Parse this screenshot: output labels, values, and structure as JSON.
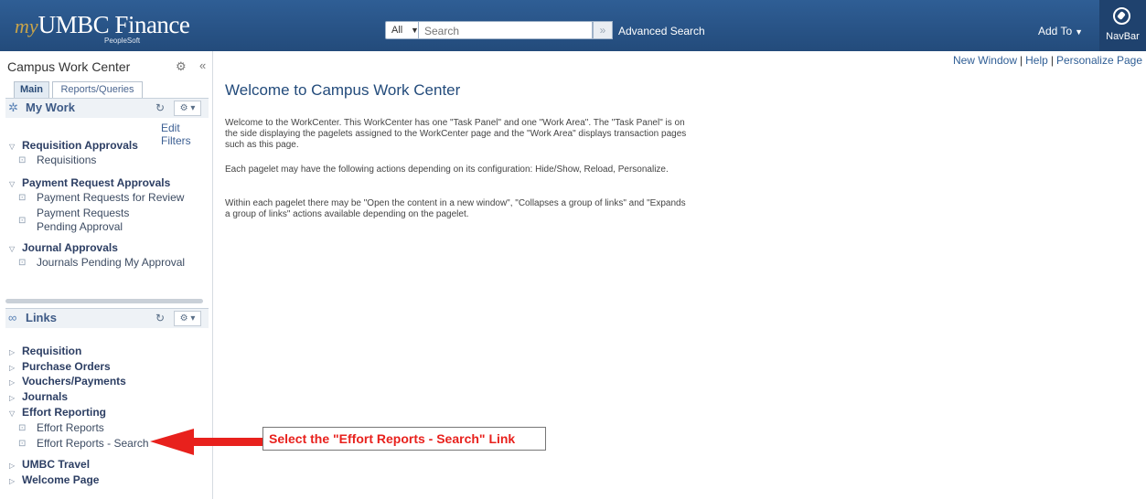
{
  "header": {
    "logo_prefix": "my",
    "logo_name": "UMBC Finance",
    "logo_sub": "PeopleSoft",
    "search_scope": "All",
    "search_placeholder": "Search",
    "advanced_search": "Advanced Search",
    "add_to": "Add To",
    "navbar": "NavBar"
  },
  "sidebar": {
    "title": "Campus Work Center",
    "tabs": [
      "Main",
      "Reports/Queries"
    ],
    "my_work": {
      "title": "My Work",
      "edit_filters": "Edit Filters",
      "groups": [
        {
          "label": "Requisition Approvals",
          "items": [
            "Requisitions"
          ]
        },
        {
          "label": "Payment Request Approvals",
          "items": [
            "Payment Requests for Review",
            "Payment Requests Pending Approval"
          ]
        },
        {
          "label": "Journal Approvals",
          "items": [
            "Journals Pending My Approval"
          ]
        }
      ]
    },
    "links": {
      "title": "Links",
      "groups": [
        "Requisition",
        "Purchase Orders",
        "Vouchers/Payments",
        "Journals",
        "Effort Reporting",
        "UMBC Travel",
        "Welcome Page"
      ],
      "effort_items": [
        "Effort Reports",
        "Effort Reports - Search"
      ]
    }
  },
  "main": {
    "top_links": [
      "New Window",
      "Help",
      "Personalize Page"
    ],
    "title": "Welcome to Campus Work Center",
    "paragraphs": [
      "Welcome to the WorkCenter. This WorkCenter has one \"Task Panel\" and one \"Work Area\". The \"Task Panel\" is on the side displaying the pagelets assigned to the WorkCenter page and the \"Work Area\" displays transaction pages such as this page.",
      "Each pagelet may have the following actions depending on its configuration: Hide/Show, Reload, Personalize.",
      "Within each pagelet there may be \"Open the content in a new window\", \"Collapses a group of links\" and \"Expands a group of links\" actions available depending on the pagelet."
    ]
  },
  "annotation": {
    "callout": "Select the \"Effort Reports - Search\" Link",
    "arrow_color": "#e8211d"
  }
}
